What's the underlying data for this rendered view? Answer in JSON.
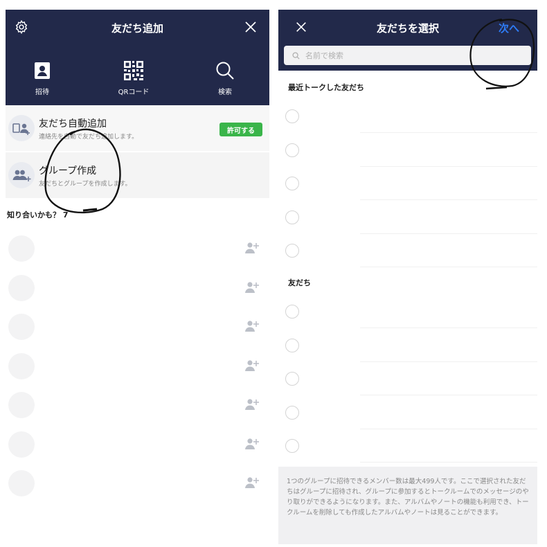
{
  "left": {
    "nav": {
      "title": "友だち追加",
      "settings_icon": "gear-icon",
      "close_icon": "close-icon"
    },
    "quick_actions": [
      {
        "label": "招待",
        "icon": "contact-card-icon"
      },
      {
        "label": "QRコード",
        "icon": "qr-code-icon"
      },
      {
        "label": "検索",
        "icon": "search-icon"
      }
    ],
    "auto_add": {
      "title": "友だち自動追加",
      "subtitle": "連絡先を自動で友だち追加します。",
      "button": "許可する"
    },
    "group_create": {
      "title": "グループ作成",
      "subtitle": "友だちとグループを作成します。"
    },
    "suggest_label": "知り合いかも？ 7",
    "suggest_count": 7
  },
  "right": {
    "nav": {
      "title": "友だちを選択",
      "next": "次へ",
      "close_icon": "close-icon"
    },
    "search": {
      "placeholder": "名前で検索",
      "icon": "search-icon"
    },
    "recent_label": "最近トークした友だち",
    "recent_count": 5,
    "friends_label": "友だち",
    "friends_count": 5,
    "info_text": "1つのグループに招待できるメンバー数は最大499人です。ここで選択された友だちはグループに招待され、グループに参加するとトークルームでのメッセージのやり取りができるようになります。また、アルバムやノートの機能も利用でき、トークルームを削除しても作成したアルバムやノートは見ることができます。"
  },
  "colors": {
    "navbar": "#22294a",
    "accent_blue": "#2e7cf6",
    "allow_green": "#3ab54a"
  }
}
